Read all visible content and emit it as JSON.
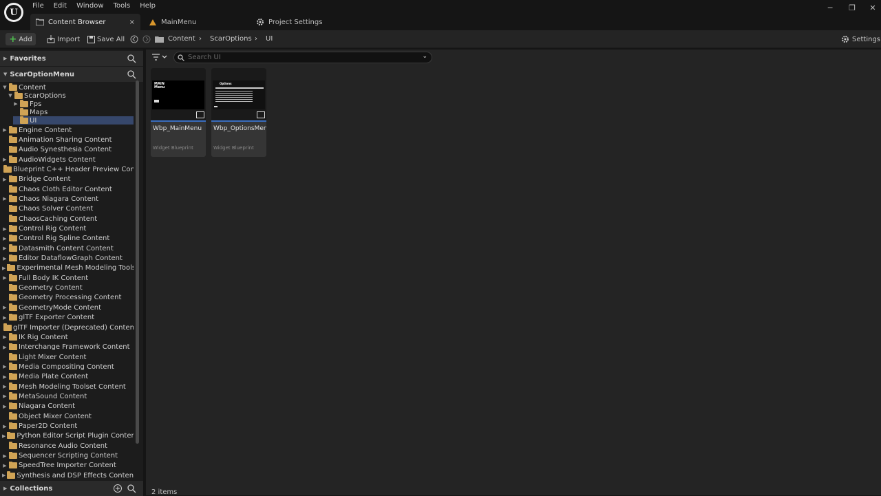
{
  "menu": [
    "File",
    "Edit",
    "Window",
    "Tools",
    "Help"
  ],
  "logo": "U",
  "window": {
    "minimize": "─",
    "restore": "❐",
    "close": "✕"
  },
  "tabs": [
    {
      "label": "Content Browser",
      "icon": "folder-icon"
    },
    {
      "label": "MainMenu",
      "icon": "level-icon"
    },
    {
      "label": "Project Settings",
      "icon": "gear-icon"
    }
  ],
  "tab_close": "×",
  "toolbar": {
    "add": "Add",
    "import": "Import",
    "save_all": "Save All",
    "settings": "Settings"
  },
  "breadcrumb": [
    "Content",
    "ScarOptions",
    "UI"
  ],
  "sidebar": {
    "favorites": "Favorites",
    "project": "ScarOptionMenu",
    "collections": "Collections"
  },
  "tree": [
    {
      "label": "Content",
      "depth": 0,
      "expanded": true
    },
    {
      "label": "ScarOptions",
      "depth": 1,
      "expanded": true
    },
    {
      "label": "Fps",
      "depth": 2,
      "arrow": true
    },
    {
      "label": "Maps",
      "depth": 2
    },
    {
      "label": "UI",
      "depth": 2,
      "selected": true
    },
    {
      "label": "Engine Content",
      "depth": 0,
      "arrow": true
    },
    {
      "label": "Animation Sharing Content",
      "depth": 0
    },
    {
      "label": "Audio Synesthesia Content",
      "depth": 0
    },
    {
      "label": "AudioWidgets Content",
      "depth": 0,
      "arrow": true
    },
    {
      "label": "Blueprint C++ Header Preview Content",
      "depth": 0
    },
    {
      "label": "Bridge Content",
      "depth": 0,
      "arrow": true
    },
    {
      "label": "Chaos Cloth Editor Content",
      "depth": 0
    },
    {
      "label": "Chaos Niagara Content",
      "depth": 0,
      "arrow": true
    },
    {
      "label": "Chaos Solver Content",
      "depth": 0
    },
    {
      "label": "ChaosCaching Content",
      "depth": 0
    },
    {
      "label": "Control Rig Content",
      "depth": 0,
      "arrow": true
    },
    {
      "label": "Control Rig Spline Content",
      "depth": 0,
      "arrow": true
    },
    {
      "label": "Datasmith Content Content",
      "depth": 0,
      "arrow": true
    },
    {
      "label": "Editor DataflowGraph Content",
      "depth": 0,
      "arrow": true
    },
    {
      "label": "Experimental Mesh Modeling Toolset Content",
      "depth": 0,
      "arrow": true
    },
    {
      "label": "Full Body IK Content",
      "depth": 0,
      "arrow": true
    },
    {
      "label": "Geometry Content",
      "depth": 0
    },
    {
      "label": "Geometry Processing Content",
      "depth": 0
    },
    {
      "label": "GeometryMode Content",
      "depth": 0,
      "arrow": true
    },
    {
      "label": "glTF Exporter Content",
      "depth": 0,
      "arrow": true
    },
    {
      "label": "glTF Importer (Deprecated) Content",
      "depth": 0
    },
    {
      "label": "IK Rig Content",
      "depth": 0,
      "arrow": true
    },
    {
      "label": "Interchange Framework Content",
      "depth": 0,
      "arrow": true
    },
    {
      "label": "Light Mixer Content",
      "depth": 0
    },
    {
      "label": "Media Compositing Content",
      "depth": 0,
      "arrow": true
    },
    {
      "label": "Media Plate Content",
      "depth": 0,
      "arrow": true
    },
    {
      "label": "Mesh Modeling Toolset Content",
      "depth": 0,
      "arrow": true
    },
    {
      "label": "MetaSound Content",
      "depth": 0,
      "arrow": true
    },
    {
      "label": "Niagara Content",
      "depth": 0,
      "arrow": true
    },
    {
      "label": "Object Mixer Content",
      "depth": 0
    },
    {
      "label": "Paper2D Content",
      "depth": 0,
      "arrow": true
    },
    {
      "label": "Python Editor Script Plugin Content",
      "depth": 0,
      "arrow": true
    },
    {
      "label": "Resonance Audio Content",
      "depth": 0
    },
    {
      "label": "Sequencer Scripting Content",
      "depth": 0,
      "arrow": true
    },
    {
      "label": "SpeedTree Importer Content",
      "depth": 0,
      "arrow": true
    },
    {
      "label": "Synthesis and DSP Effects Content",
      "depth": 0,
      "arrow": true
    }
  ],
  "search": {
    "placeholder": "Search UI"
  },
  "assets": [
    {
      "name": "Wbp_MainMenu",
      "type": "Widget Blueprint",
      "thumb_title": "MAIN\nMenu"
    },
    {
      "name": "Wbp_OptionsMenu",
      "type": "Widget Blueprint",
      "thumb_title": "Options"
    }
  ],
  "status": "2 items",
  "colors": {
    "accent": "#3a6ec0",
    "folder": "#d0a355",
    "add_plus": "#4fbf4f",
    "selection": "#36476b"
  }
}
